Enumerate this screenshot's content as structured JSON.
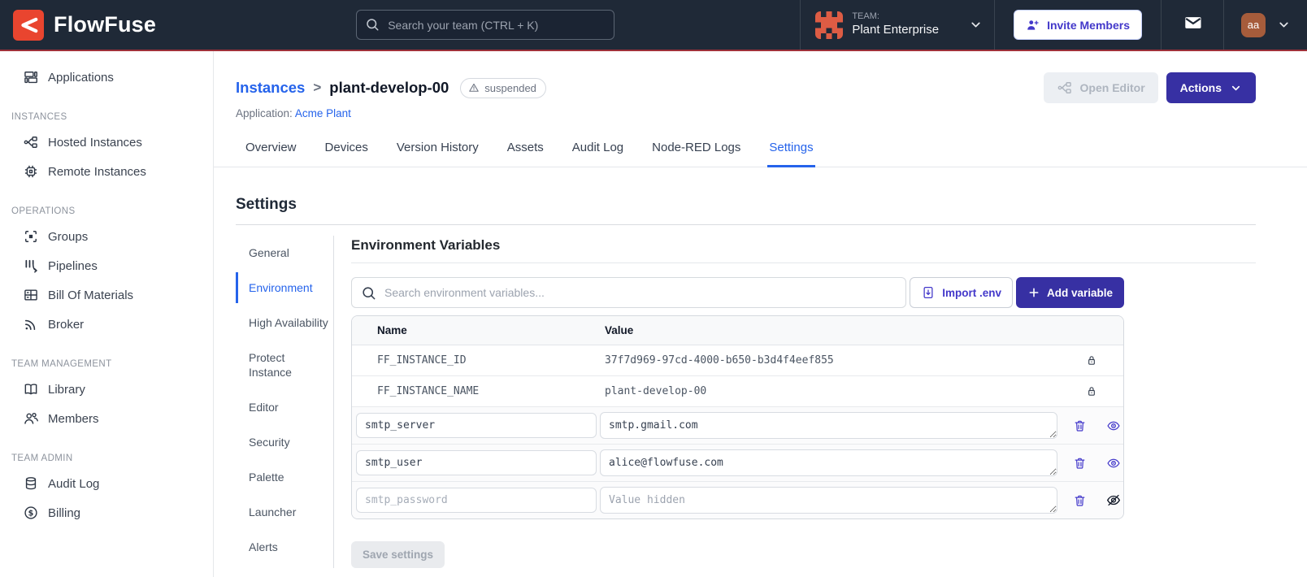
{
  "navbar": {
    "brand": "FlowFuse",
    "search_placeholder": "Search your team (CTRL + K)",
    "team_label": "TEAM:",
    "team_name": "Plant Enterprise",
    "invite_label": "Invite Members",
    "avatar_initials": "aa"
  },
  "sidebar": {
    "sections": [
      {
        "header": "",
        "items": [
          {
            "label": "Applications",
            "icon": "applications-icon"
          }
        ]
      },
      {
        "header": "INSTANCES",
        "items": [
          {
            "label": "Hosted Instances",
            "icon": "fork-icon"
          },
          {
            "label": "Remote Instances",
            "icon": "chip-icon"
          }
        ]
      },
      {
        "header": "OPERATIONS",
        "items": [
          {
            "label": "Groups",
            "icon": "chip-brackets-icon"
          },
          {
            "label": "Pipelines",
            "icon": "pipelines-icon"
          },
          {
            "label": "Bill Of Materials",
            "icon": "table-icon"
          },
          {
            "label": "Broker",
            "icon": "rss-icon"
          }
        ]
      },
      {
        "header": "TEAM MANAGEMENT",
        "items": [
          {
            "label": "Library",
            "icon": "book-icon"
          },
          {
            "label": "Members",
            "icon": "users-icon"
          }
        ]
      },
      {
        "header": "TEAM ADMIN",
        "items": [
          {
            "label": "Audit Log",
            "icon": "database-icon"
          },
          {
            "label": "Billing",
            "icon": "dollar-icon"
          }
        ]
      }
    ]
  },
  "header": {
    "breadcrumb_parent": "Instances",
    "breadcrumb_separator": ">",
    "instance_name": "plant-develop-00",
    "status_badge": "suspended",
    "application_label": "Application:",
    "application_name": "Acme Plant",
    "open_editor_label": "Open Editor",
    "actions_label": "Actions"
  },
  "tabs": [
    "Overview",
    "Devices",
    "Version History",
    "Assets",
    "Audit Log",
    "Node-RED Logs",
    "Settings"
  ],
  "settings": {
    "title": "Settings",
    "nav": [
      "General",
      "Environment",
      "High Availability",
      "Protect Instance",
      "Editor",
      "Security",
      "Palette",
      "Launcher",
      "Alerts"
    ],
    "active_nav": "Environment"
  },
  "env": {
    "title": "Environment Variables",
    "search_placeholder": "Search environment variables...",
    "import_label": "Import .env",
    "add_label": "Add variable",
    "save_label": "Save settings",
    "table": {
      "columns": [
        "Name",
        "Value"
      ],
      "locked_rows": [
        {
          "name": "FF_INSTANCE_ID",
          "value": "37f7d969-97cd-4000-b650-b3d4f4eef855"
        },
        {
          "name": "FF_INSTANCE_NAME",
          "value": "plant-develop-00"
        }
      ],
      "editable_rows": [
        {
          "name": "smtp_server",
          "value": "smtp.gmail.com",
          "hidden": false
        },
        {
          "name": "smtp_user",
          "value": "alice@flowfuse.com",
          "hidden": false
        },
        {
          "name": "smtp_password",
          "value": "",
          "value_placeholder": "Value hidden",
          "hidden": true
        }
      ]
    }
  },
  "colors": {
    "navbar_bg": "#1f2937",
    "navbar_red_line": "#9e3039",
    "brand_red": "#e9452f",
    "accent_indigo": "#3730a3",
    "link_blue": "#2563eb",
    "avatar_brown": "#a65c3b"
  }
}
